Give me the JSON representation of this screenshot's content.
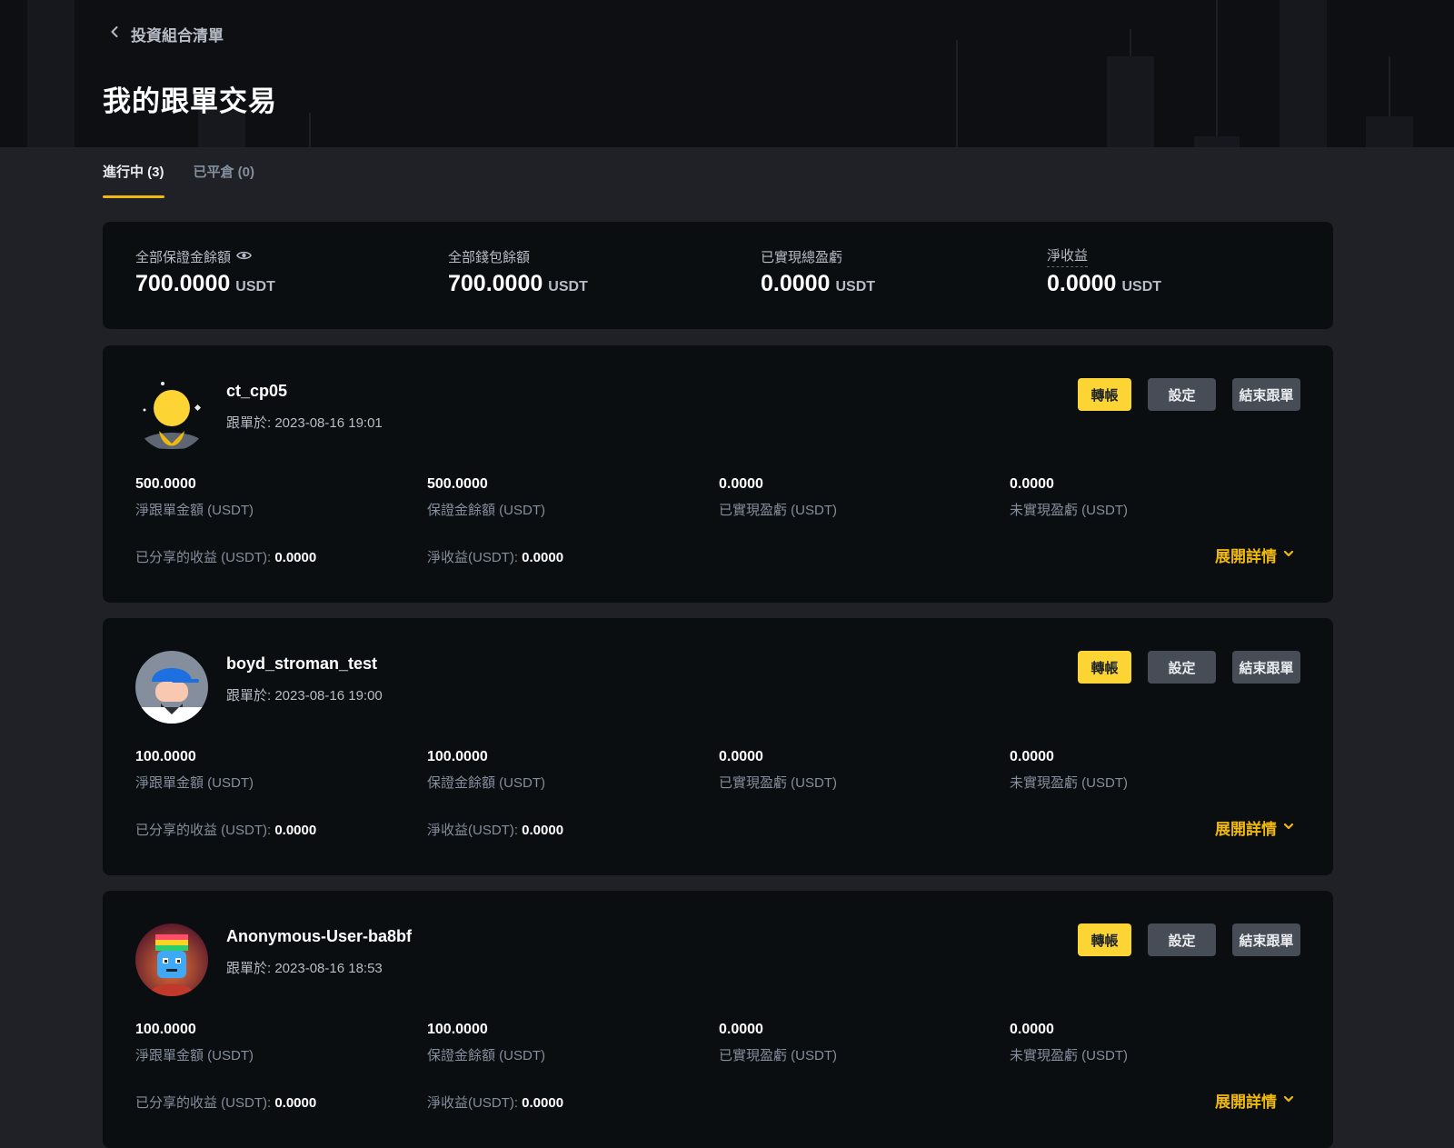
{
  "header": {
    "back_label": "投資組合清單",
    "title": "我的跟單交易"
  },
  "tabs": [
    {
      "label": "進行中 (3)",
      "active": true
    },
    {
      "label": "已平倉 (0)",
      "active": false
    }
  ],
  "summary": {
    "unit": "USDT",
    "items": [
      {
        "label": "全部保證金餘額",
        "value": "700.0000"
      },
      {
        "label": "全部錢包餘額",
        "value": "700.0000"
      },
      {
        "label": "已實現總盈虧",
        "value": "0.0000"
      },
      {
        "label": "淨收益",
        "value": "0.0000"
      }
    ]
  },
  "buttons": {
    "transfer": "轉帳",
    "settings": "設定",
    "end": "結束跟單"
  },
  "labels": {
    "net_copy_amount": "淨跟單金額 (USDT)",
    "margin_balance": "保證金餘額 (USDT)",
    "realized_pnl": "已實現盈虧 (USDT)",
    "unrealized_pnl": "未實現盈虧 (USDT)",
    "shared_profit": "已分享的收益 (USDT): ",
    "net_profit": "淨收益(USDT): ",
    "expand": "展開詳情"
  },
  "cards": [
    {
      "name": "ct_cp05",
      "followed_at": "跟單於: 2023-08-16 19:01",
      "net_copy_amount": "500.0000",
      "margin_balance": "500.0000",
      "realized_pnl": "0.0000",
      "unrealized_pnl": "0.0000",
      "shared_profit": "0.0000",
      "net_profit": "0.0000"
    },
    {
      "name": "boyd_stroman_test",
      "followed_at": "跟單於: 2023-08-16 19:00",
      "net_copy_amount": "100.0000",
      "margin_balance": "100.0000",
      "realized_pnl": "0.0000",
      "unrealized_pnl": "0.0000",
      "shared_profit": "0.0000",
      "net_profit": "0.0000"
    },
    {
      "name": "Anonymous-User-ba8bf",
      "followed_at": "跟單於: 2023-08-16 18:53",
      "net_copy_amount": "100.0000",
      "margin_balance": "100.0000",
      "realized_pnl": "0.0000",
      "unrealized_pnl": "0.0000",
      "shared_profit": "0.0000",
      "net_profit": "0.0000"
    }
  ],
  "colors": {
    "accent": "#f0b90b",
    "button_yellow": "#fcd535",
    "button_gray": "#474d57",
    "card_bg": "#0b0e11",
    "page_bg": "#1f2127"
  }
}
